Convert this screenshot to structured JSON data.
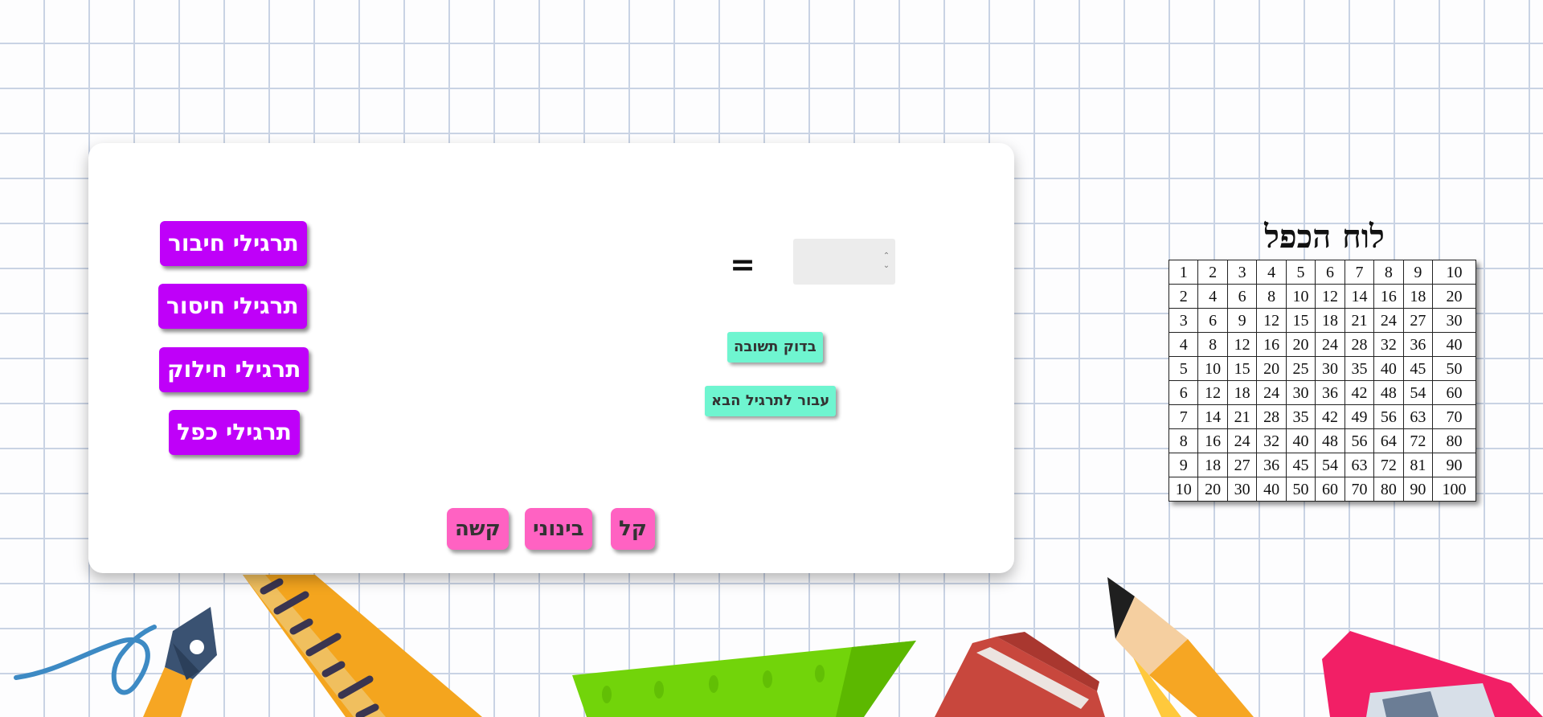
{
  "operations": [
    "תרגילי חיבור",
    "תרגילי חיסור",
    "תרגילי חילוק",
    "תרגילי כפל"
  ],
  "difficulty": {
    "hard": "קשה",
    "medium": "בינוני",
    "easy": "קל"
  },
  "exercise": {
    "equals": "=",
    "answer_value": ""
  },
  "actions": {
    "check": "בדוק תשובה",
    "next": "עבור לתרגיל הבא"
  },
  "multiplication_table": {
    "title": "לוח הכפל",
    "rows": [
      [
        "1",
        "2",
        "3",
        "4",
        "5",
        "6",
        "7",
        "8",
        "9",
        "10"
      ],
      [
        "2",
        "4",
        "6",
        "8",
        "10",
        "12",
        "14",
        "16",
        "18",
        "20"
      ],
      [
        "3",
        "6",
        "9",
        "12",
        "15",
        "18",
        "21",
        "24",
        "27",
        "30"
      ],
      [
        "4",
        "8",
        "12",
        "16",
        "20",
        "24",
        "28",
        "32",
        "36",
        "40"
      ],
      [
        "5",
        "10",
        "15",
        "20",
        "25",
        "30",
        "35",
        "40",
        "45",
        "50"
      ],
      [
        "6",
        "12",
        "18",
        "24",
        "30",
        "36",
        "42",
        "48",
        "54",
        "60"
      ],
      [
        "7",
        "14",
        "21",
        "28",
        "35",
        "42",
        "49",
        "56",
        "63",
        "70"
      ],
      [
        "8",
        "16",
        "24",
        "32",
        "40",
        "48",
        "56",
        "64",
        "72",
        "80"
      ],
      [
        "9",
        "18",
        "27",
        "36",
        "45",
        "54",
        "63",
        "72",
        "81",
        "90"
      ],
      [
        "10",
        "20",
        "30",
        "40",
        "50",
        "60",
        "70",
        "80",
        "90",
        "100"
      ]
    ]
  },
  "colors": {
    "operation_button": "#bf00f9",
    "difficulty_button": "#ff62c2",
    "action_button": "#6ff5d0",
    "grid_lines": "#c9d3e4"
  }
}
